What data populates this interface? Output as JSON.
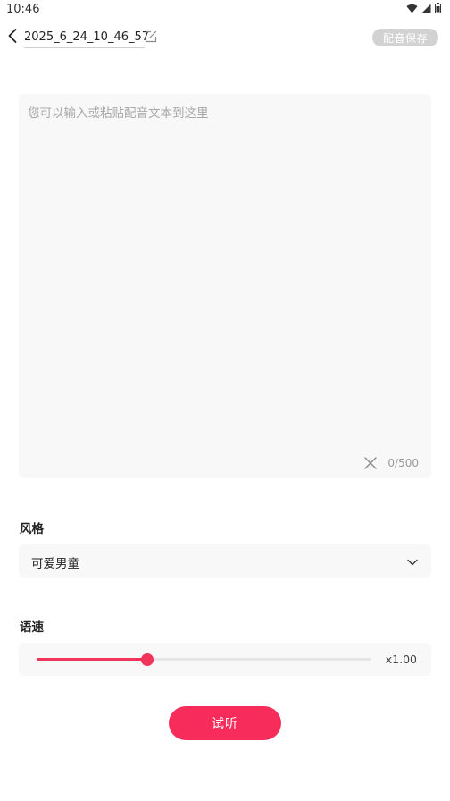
{
  "status_bar": {
    "time": "10:46",
    "icons": [
      "wifi-icon",
      "signal-icon",
      "battery-icon"
    ]
  },
  "toolbar": {
    "title": "2025_6_24_10_46_57",
    "save_label": "配音保存",
    "icons": [
      "back-arrow-icon",
      "edit-icon"
    ]
  },
  "editor": {
    "placeholder": "您可以输入或粘贴配音文本到这里",
    "value": "",
    "char_count": "0/500"
  },
  "style_section": {
    "label": "风格",
    "selected": "可爱男童"
  },
  "speed_section": {
    "label": "语速",
    "value_text": "x1.00",
    "slider_fraction": 0.33
  },
  "listen_button": {
    "label": "试听"
  },
  "colors": {
    "accent": "#f72c5b",
    "slider": "#f2335a",
    "disabled_button": "#d2d2d2",
    "field_background": "#f8f8f8"
  }
}
